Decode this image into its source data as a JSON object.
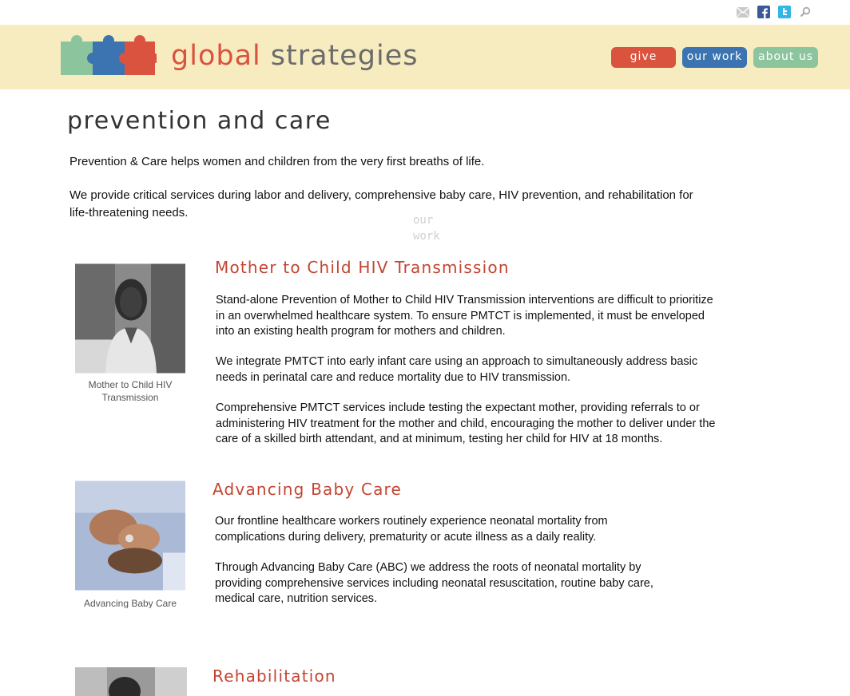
{
  "topbar": {
    "icons": [
      "mail-icon",
      "facebook-icon",
      "twitter-icon",
      "search-icon"
    ]
  },
  "brand": {
    "word1": "global",
    "word2": "strategies",
    "puzzle_colors": [
      "#8cc49e",
      "#3b74b0",
      "#d9533e"
    ]
  },
  "nav": {
    "give": "give",
    "our_work": "our work",
    "about_us": "about us"
  },
  "colors": {
    "header_bg": "#f7ecc0",
    "accent_red": "#d9533e",
    "accent_blue": "#3b74b0",
    "accent_green": "#8cc49e",
    "section_title": "#c44431"
  },
  "page": {
    "title": "prevention and care",
    "intro1": "Prevention & Care helps women and children from the very first breaths of life.",
    "intro2": "We provide critical services during labor and delivery, comprehensive baby care, HIV prevention, and rehabilitation for life-threatening needs.",
    "ghost_text": "our work"
  },
  "sections": [
    {
      "title": "Mother to Child HIV Transmission",
      "caption": "Mother to Child HIV Transmission",
      "paragraphs": [
        "Stand-alone Prevention of Mother to Child HIV Transmission interventions are difficult to prioritize in an overwhelmed healthcare system.  To ensure PMTCT is implemented, it must be enveloped into an existing health program for mothers and children.",
        "We integrate PMTCT into early infant care using an approach to simultaneously address basic needs in perinatal care and reduce mortality due to HIV transmission.",
        "Comprehensive PMTCT services include testing the expectant mother, providing referrals to or administering HIV treatment for the mother and child, encouraging the mother to deliver under the care of a skilled birth attendant, and at minimum, testing her child for HIV at 18 months."
      ]
    },
    {
      "title": "Advancing Baby Care",
      "caption": "Advancing Baby Care",
      "paragraphs": [
        "Our frontline healthcare workers routinely experience neonatal mortality from complications during delivery, prematurity or acute illness as a daily reality.",
        "Through Advancing Baby Care (ABC) we address the roots of neonatal mortality by providing comprehensive services including neonatal resuscitation, routine baby care, medical care, nutrition services."
      ]
    },
    {
      "title": "Rehabilitation"
    }
  ]
}
